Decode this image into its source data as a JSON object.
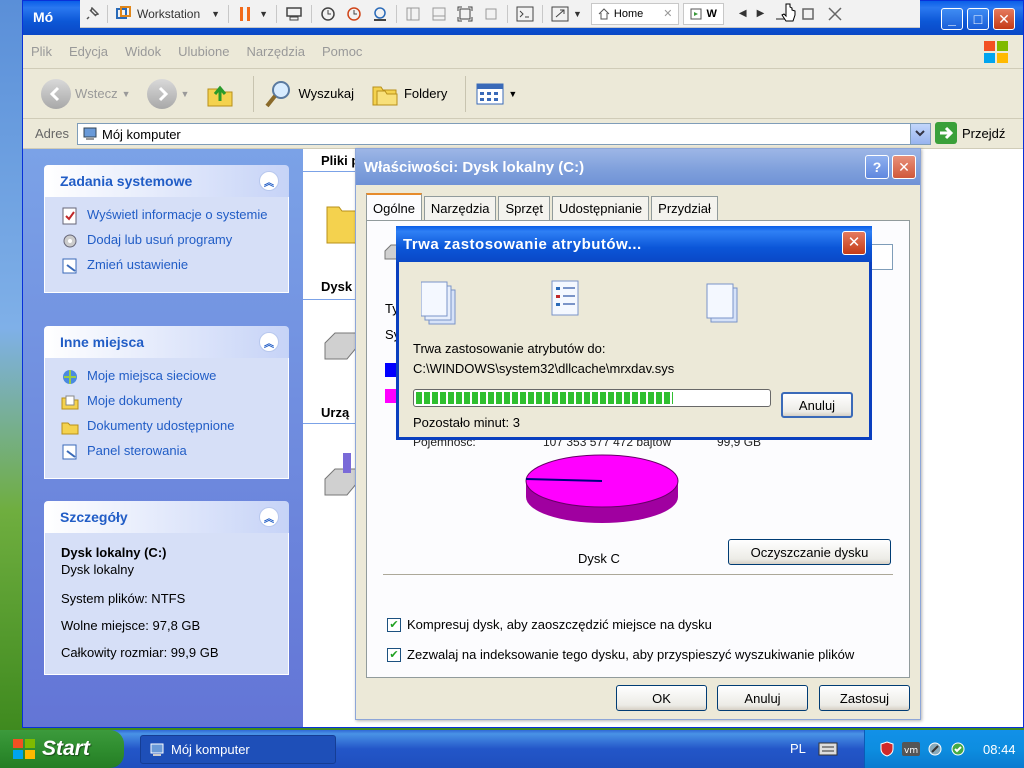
{
  "vmware_toolbar": {
    "vm_name": "Workstation",
    "home_tab": "Home",
    "vm_tab": "W"
  },
  "explorer": {
    "title_partial": "Mó",
    "menu": [
      "Plik",
      "Edycja",
      "Widok",
      "Ulubione",
      "Narzędzia",
      "Pomoc"
    ],
    "toolbar": {
      "back": "Wstecz",
      "search": "Wyszukaj",
      "folders": "Foldery"
    },
    "address_label": "Adres",
    "address_value": "Mój komputer",
    "go_label": "Przejdź"
  },
  "task_pane": {
    "system_tasks": {
      "title": "Zadania systemowe",
      "items": [
        "Wyświetl informacje o systemie",
        "Dodaj lub usuń programy",
        "Zmień ustawienie"
      ]
    },
    "other_places": {
      "title": "Inne miejsca",
      "items": [
        "Moje miejsca sieciowe",
        "Moje dokumenty",
        "Dokumenty udostępnione",
        "Panel sterowania"
      ]
    },
    "details": {
      "title": "Szczegóły",
      "name": "Dysk lokalny (C:)",
      "type": "Dysk lokalny",
      "filesystem": "System plików: NTFS",
      "free": "Wolne miejsce: 97,8 GB",
      "total": "Całkowity rozmiar: 99,9 GB"
    }
  },
  "content": {
    "group_files": "Pliki p",
    "group_disks": "Dysk",
    "group_devices": "Urzą"
  },
  "properties": {
    "title": "Właściwości: Dysk lokalny (C:)",
    "tabs": [
      "Ogólne",
      "Narzędzia",
      "Sprzęt",
      "Udostępnianie",
      "Przydział"
    ],
    "partial_labels": [
      "Ty",
      "Sy"
    ],
    "capacity_row": {
      "label": "Pojemność:",
      "bytes": "107 353 577 472 bajtów",
      "gb": "99,9 GB"
    },
    "pie_label": "Dysk C",
    "cleanup_button": "Oczyszczanie dysku",
    "compress_label": "Kompresuj dysk, aby zaoszczędzić miejsce na dysku",
    "index_label": "Zezwalaj na indeksowanie tego dysku, aby przyspieszyć wyszukiwanie plików",
    "compress_checked": true,
    "index_checked": true,
    "ok": "OK",
    "cancel": "Anuluj",
    "apply": "Zastosuj",
    "colors": {
      "used": "#0000ff",
      "free": "#ff00ff"
    }
  },
  "apply_dialog": {
    "title": "Trwa zastosowanie atrybutów...",
    "line1": "Trwa zastosowanie atrybutów do:",
    "path": "C:\\WINDOWS\\system32\\dllcache\\mrxdav.sys",
    "remaining": "Pozostało minut: 3",
    "cancel": "Anuluj",
    "progress_fraction": 0.73
  },
  "taskbar": {
    "start": "Start",
    "window_item": "Mój komputer",
    "language": "PL",
    "clock": "08:44"
  }
}
